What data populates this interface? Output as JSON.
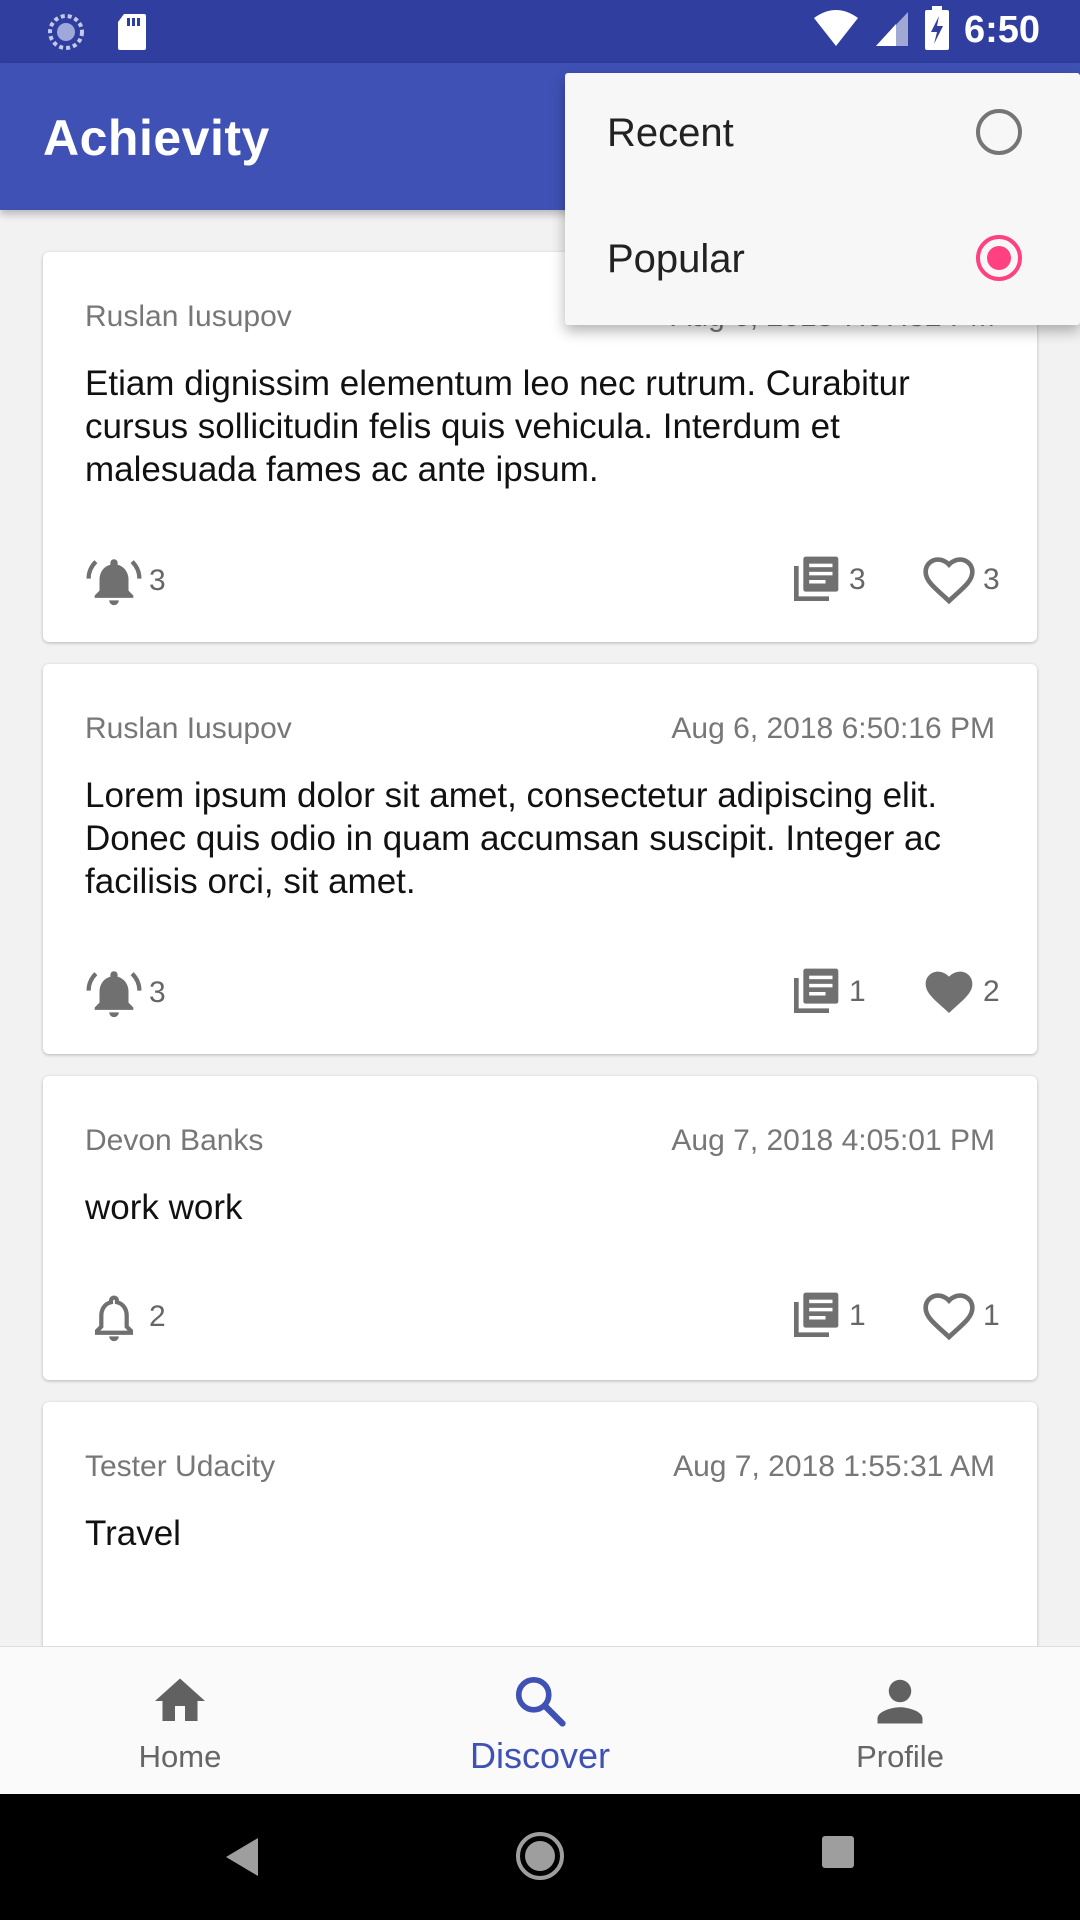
{
  "status_bar": {
    "time": "6:50"
  },
  "app_bar": {
    "title": "Achievity"
  },
  "sort_menu": {
    "options": [
      {
        "label": "Recent",
        "selected": false
      },
      {
        "label": "Popular",
        "selected": true
      }
    ]
  },
  "posts": [
    {
      "author": "Ruslan Iusupov",
      "date": "Aug 6, 2018 7:07:32 PM",
      "body": "Etiam dignissim elementum leo nec rutrum. Curabitur cursus sollicitudin felis quis vehicula. Interdum et malesuada fames ac ante ipsum.",
      "followers": "3",
      "followers_icon": "bell-ringing-icon",
      "achievements": "3",
      "likes": "3",
      "liked": false
    },
    {
      "author": "Ruslan Iusupov",
      "date": "Aug 6, 2018 6:50:16 PM",
      "body": "Lorem ipsum dolor sit amet, consectetur adipiscing elit. Donec quis odio in quam accumsan suscipit. Integer ac facilisis orci, sit amet.",
      "followers": "3",
      "followers_icon": "bell-ringing-icon",
      "achievements": "1",
      "likes": "2",
      "liked": true
    },
    {
      "author": "Devon Banks",
      "date": "Aug 7, 2018 4:05:01 PM",
      "body": "work work",
      "followers": "2",
      "followers_icon": "bell-outline-icon",
      "achievements": "1",
      "likes": "1",
      "liked": false
    },
    {
      "author": "Tester Udacity",
      "date": "Aug 7, 2018 1:55:31 AM",
      "body": "Travel"
    }
  ],
  "bottom_nav": {
    "items": [
      {
        "label": "Home",
        "icon": "home-icon",
        "active": false
      },
      {
        "label": "Discover",
        "icon": "search-icon",
        "active": true
      },
      {
        "label": "Profile",
        "icon": "person-icon",
        "active": false
      }
    ]
  },
  "colors": {
    "primary": "#3f51b5",
    "primary_dark": "#303f9f",
    "accent": "#ff4081"
  }
}
